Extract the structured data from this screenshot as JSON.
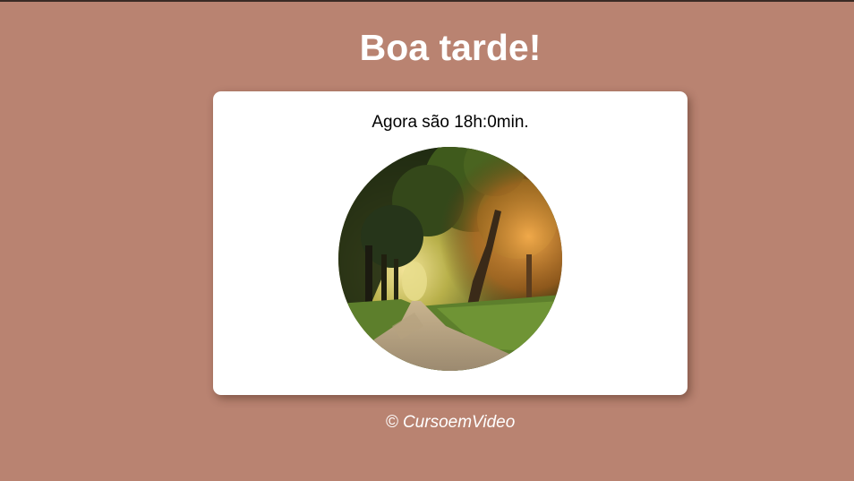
{
  "greeting": "Boa tarde!",
  "time_message": "Agora são 18h:0min.",
  "footer": "© CursoemVideo",
  "image": {
    "alt": "afternoon forest path"
  },
  "colors": {
    "background": "#b98371",
    "card": "#ffffff",
    "heading_text": "#ffffff"
  }
}
